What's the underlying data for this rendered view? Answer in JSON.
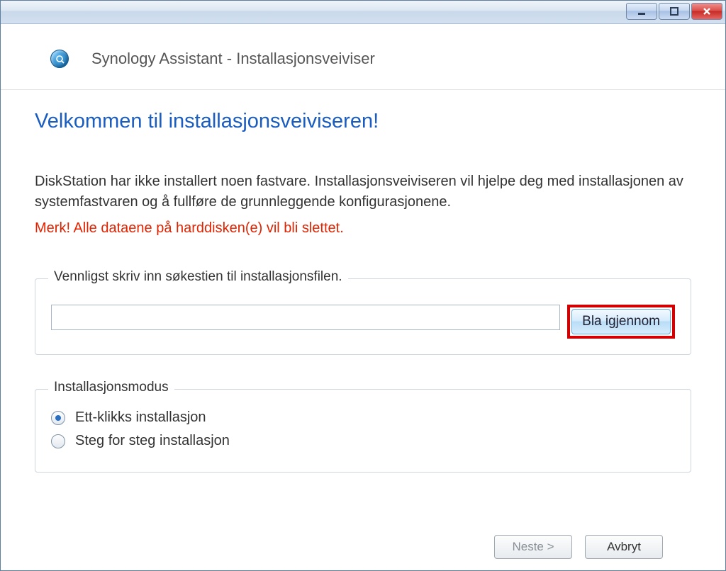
{
  "titlebar": {
    "minimize_name": "minimize",
    "maximize_name": "maximize",
    "close_name": "close"
  },
  "header": {
    "app_title": "Synology Assistant - Installasjonsveiviser"
  },
  "page": {
    "headline": "Velkommen til installasjonsveiviseren!",
    "description": "DiskStation har ikke installert noen fastvare. Installasjonsveiviseren vil hjelpe deg med installasjonen av systemfastvaren og å fullføre de grunnleggende konfigurasjonene.",
    "warning": "Merk! Alle dataene på harddisken(e) vil bli slettet."
  },
  "path_group": {
    "legend": "Vennligst skriv inn søkestien til installasjonsfilen.",
    "value": "",
    "browse_label": "Bla igjennom"
  },
  "mode_group": {
    "legend": "Installasjonsmodus",
    "option_one_click": "Ett-klikks installasjon",
    "option_step": "Steg for steg installasjon",
    "selected": "one_click"
  },
  "footer": {
    "next_label": "Neste >",
    "cancel_label": "Avbryt"
  }
}
